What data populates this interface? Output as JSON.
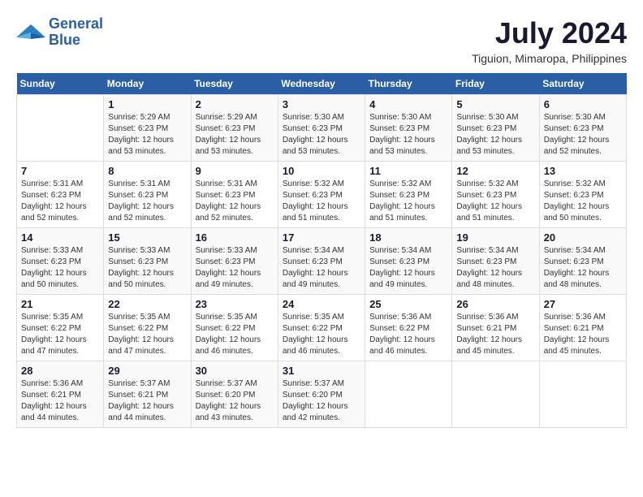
{
  "logo": {
    "line1": "General",
    "line2": "Blue"
  },
  "title": "July 2024",
  "location": "Tiguion, Mimaropa, Philippines",
  "days_of_week": [
    "Sunday",
    "Monday",
    "Tuesday",
    "Wednesday",
    "Thursday",
    "Friday",
    "Saturday"
  ],
  "weeks": [
    [
      {
        "num": "",
        "sunrise": "",
        "sunset": "",
        "daylight": ""
      },
      {
        "num": "1",
        "sunrise": "Sunrise: 5:29 AM",
        "sunset": "Sunset: 6:23 PM",
        "daylight": "Daylight: 12 hours and 53 minutes."
      },
      {
        "num": "2",
        "sunrise": "Sunrise: 5:29 AM",
        "sunset": "Sunset: 6:23 PM",
        "daylight": "Daylight: 12 hours and 53 minutes."
      },
      {
        "num": "3",
        "sunrise": "Sunrise: 5:30 AM",
        "sunset": "Sunset: 6:23 PM",
        "daylight": "Daylight: 12 hours and 53 minutes."
      },
      {
        "num": "4",
        "sunrise": "Sunrise: 5:30 AM",
        "sunset": "Sunset: 6:23 PM",
        "daylight": "Daylight: 12 hours and 53 minutes."
      },
      {
        "num": "5",
        "sunrise": "Sunrise: 5:30 AM",
        "sunset": "Sunset: 6:23 PM",
        "daylight": "Daylight: 12 hours and 53 minutes."
      },
      {
        "num": "6",
        "sunrise": "Sunrise: 5:30 AM",
        "sunset": "Sunset: 6:23 PM",
        "daylight": "Daylight: 12 hours and 52 minutes."
      }
    ],
    [
      {
        "num": "7",
        "sunrise": "Sunrise: 5:31 AM",
        "sunset": "Sunset: 6:23 PM",
        "daylight": "Daylight: 12 hours and 52 minutes."
      },
      {
        "num": "8",
        "sunrise": "Sunrise: 5:31 AM",
        "sunset": "Sunset: 6:23 PM",
        "daylight": "Daylight: 12 hours and 52 minutes."
      },
      {
        "num": "9",
        "sunrise": "Sunrise: 5:31 AM",
        "sunset": "Sunset: 6:23 PM",
        "daylight": "Daylight: 12 hours and 52 minutes."
      },
      {
        "num": "10",
        "sunrise": "Sunrise: 5:32 AM",
        "sunset": "Sunset: 6:23 PM",
        "daylight": "Daylight: 12 hours and 51 minutes."
      },
      {
        "num": "11",
        "sunrise": "Sunrise: 5:32 AM",
        "sunset": "Sunset: 6:23 PM",
        "daylight": "Daylight: 12 hours and 51 minutes."
      },
      {
        "num": "12",
        "sunrise": "Sunrise: 5:32 AM",
        "sunset": "Sunset: 6:23 PM",
        "daylight": "Daylight: 12 hours and 51 minutes."
      },
      {
        "num": "13",
        "sunrise": "Sunrise: 5:32 AM",
        "sunset": "Sunset: 6:23 PM",
        "daylight": "Daylight: 12 hours and 50 minutes."
      }
    ],
    [
      {
        "num": "14",
        "sunrise": "Sunrise: 5:33 AM",
        "sunset": "Sunset: 6:23 PM",
        "daylight": "Daylight: 12 hours and 50 minutes."
      },
      {
        "num": "15",
        "sunrise": "Sunrise: 5:33 AM",
        "sunset": "Sunset: 6:23 PM",
        "daylight": "Daylight: 12 hours and 50 minutes."
      },
      {
        "num": "16",
        "sunrise": "Sunrise: 5:33 AM",
        "sunset": "Sunset: 6:23 PM",
        "daylight": "Daylight: 12 hours and 49 minutes."
      },
      {
        "num": "17",
        "sunrise": "Sunrise: 5:34 AM",
        "sunset": "Sunset: 6:23 PM",
        "daylight": "Daylight: 12 hours and 49 minutes."
      },
      {
        "num": "18",
        "sunrise": "Sunrise: 5:34 AM",
        "sunset": "Sunset: 6:23 PM",
        "daylight": "Daylight: 12 hours and 49 minutes."
      },
      {
        "num": "19",
        "sunrise": "Sunrise: 5:34 AM",
        "sunset": "Sunset: 6:23 PM",
        "daylight": "Daylight: 12 hours and 48 minutes."
      },
      {
        "num": "20",
        "sunrise": "Sunrise: 5:34 AM",
        "sunset": "Sunset: 6:23 PM",
        "daylight": "Daylight: 12 hours and 48 minutes."
      }
    ],
    [
      {
        "num": "21",
        "sunrise": "Sunrise: 5:35 AM",
        "sunset": "Sunset: 6:22 PM",
        "daylight": "Daylight: 12 hours and 47 minutes."
      },
      {
        "num": "22",
        "sunrise": "Sunrise: 5:35 AM",
        "sunset": "Sunset: 6:22 PM",
        "daylight": "Daylight: 12 hours and 47 minutes."
      },
      {
        "num": "23",
        "sunrise": "Sunrise: 5:35 AM",
        "sunset": "Sunset: 6:22 PM",
        "daylight": "Daylight: 12 hours and 46 minutes."
      },
      {
        "num": "24",
        "sunrise": "Sunrise: 5:35 AM",
        "sunset": "Sunset: 6:22 PM",
        "daylight": "Daylight: 12 hours and 46 minutes."
      },
      {
        "num": "25",
        "sunrise": "Sunrise: 5:36 AM",
        "sunset": "Sunset: 6:22 PM",
        "daylight": "Daylight: 12 hours and 46 minutes."
      },
      {
        "num": "26",
        "sunrise": "Sunrise: 5:36 AM",
        "sunset": "Sunset: 6:21 PM",
        "daylight": "Daylight: 12 hours and 45 minutes."
      },
      {
        "num": "27",
        "sunrise": "Sunrise: 5:36 AM",
        "sunset": "Sunset: 6:21 PM",
        "daylight": "Daylight: 12 hours and 45 minutes."
      }
    ],
    [
      {
        "num": "28",
        "sunrise": "Sunrise: 5:36 AM",
        "sunset": "Sunset: 6:21 PM",
        "daylight": "Daylight: 12 hours and 44 minutes."
      },
      {
        "num": "29",
        "sunrise": "Sunrise: 5:37 AM",
        "sunset": "Sunset: 6:21 PM",
        "daylight": "Daylight: 12 hours and 44 minutes."
      },
      {
        "num": "30",
        "sunrise": "Sunrise: 5:37 AM",
        "sunset": "Sunset: 6:20 PM",
        "daylight": "Daylight: 12 hours and 43 minutes."
      },
      {
        "num": "31",
        "sunrise": "Sunrise: 5:37 AM",
        "sunset": "Sunset: 6:20 PM",
        "daylight": "Daylight: 12 hours and 42 minutes."
      },
      {
        "num": "",
        "sunrise": "",
        "sunset": "",
        "daylight": ""
      },
      {
        "num": "",
        "sunrise": "",
        "sunset": "",
        "daylight": ""
      },
      {
        "num": "",
        "sunrise": "",
        "sunset": "",
        "daylight": ""
      }
    ]
  ]
}
